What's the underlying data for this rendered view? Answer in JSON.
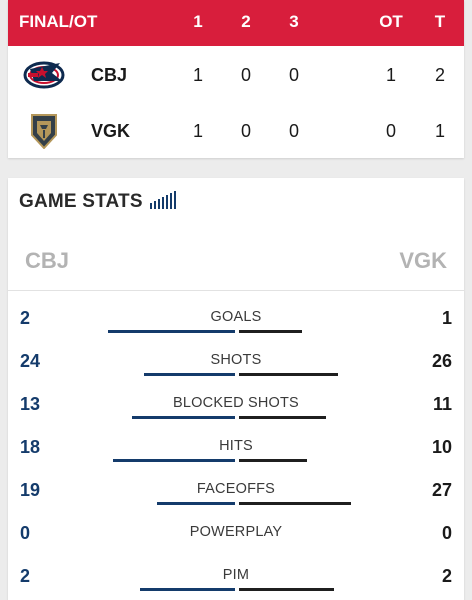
{
  "scoreboard": {
    "status": "FINAL/OT",
    "periods": [
      "1",
      "2",
      "3"
    ],
    "ot_label": "OT",
    "total_label": "T",
    "teams": [
      {
        "abbr": "CBJ",
        "periods": [
          "1",
          "0",
          "0"
        ],
        "ot": "1",
        "total": "2",
        "logo": "blue-jackets-logo",
        "color": "#0e2a4f"
      },
      {
        "abbr": "VGK",
        "periods": [
          "1",
          "0",
          "0"
        ],
        "ot": "0",
        "total": "1",
        "logo": "golden-knights-logo",
        "color": "#b4975a"
      }
    ]
  },
  "game_stats": {
    "title": "GAME STATS",
    "icon": "bar-chart-icon",
    "away_team": "CBJ",
    "home_team": "VGK",
    "away_color": "#143b6b",
    "home_color": "#1f1f1f",
    "rows": [
      {
        "label": "GOALS",
        "away": "2",
        "home": "1",
        "away_share": 0.67,
        "home_share": 0.33
      },
      {
        "label": "SHOTS",
        "away": "24",
        "home": "26",
        "away_share": 0.48,
        "home_share": 0.52
      },
      {
        "label": "BLOCKED SHOTS",
        "away": "13",
        "home": "11",
        "away_share": 0.54,
        "home_share": 0.46
      },
      {
        "label": "HITS",
        "away": "18",
        "home": "10",
        "away_share": 0.64,
        "home_share": 0.36
      },
      {
        "label": "FACEOFFS",
        "away": "19",
        "home": "27",
        "away_share": 0.41,
        "home_share": 0.59
      },
      {
        "label": "POWERPLAY",
        "away": "0",
        "home": "0",
        "away_share": 0,
        "home_share": 0
      },
      {
        "label": "PIM",
        "away": "2",
        "home": "2",
        "away_share": 0.5,
        "home_share": 0.5
      }
    ]
  },
  "colors": {
    "header_red": "#d81e3c",
    "background": "#ececec"
  }
}
